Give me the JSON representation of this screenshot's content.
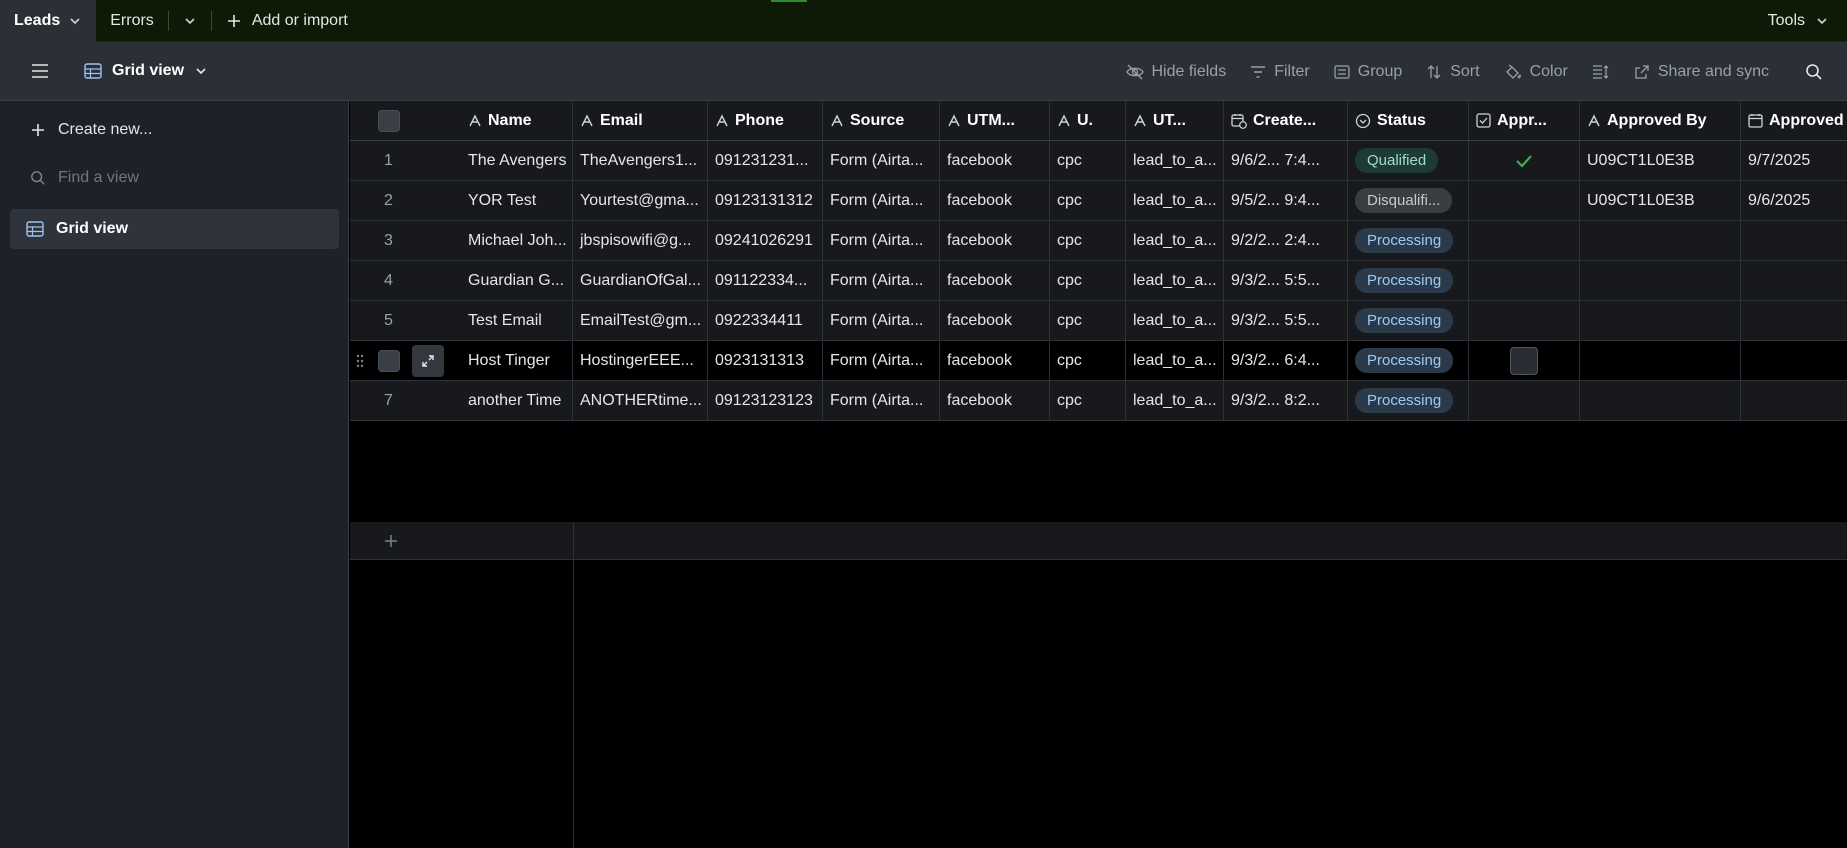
{
  "topbar": {
    "tabs": [
      {
        "label": "Leads"
      },
      {
        "label": "Errors"
      }
    ],
    "add_import_label": "Add or import",
    "tools_label": "Tools"
  },
  "viewbar": {
    "view_name": "Grid view",
    "toolbar": {
      "hide_fields": "Hide fields",
      "filter": "Filter",
      "group": "Group",
      "sort": "Sort",
      "color": "Color",
      "share_sync": "Share and sync"
    }
  },
  "sidebar": {
    "create_new": "Create new...",
    "find_view_placeholder": "Find a view",
    "views": [
      {
        "label": "Grid view"
      }
    ]
  },
  "table": {
    "columns": [
      "Name",
      "Email",
      "Phone",
      "Source",
      "UTM...",
      "U.",
      "UT...",
      "Create...",
      "Status",
      "Appr...",
      "Approved By",
      "Approved"
    ],
    "rows": [
      {
        "idx": "1",
        "name": "The Avengers",
        "email": "TheAvengers1...",
        "phone": "091231231...",
        "source": "Form (Airta...",
        "utm_source": "facebook",
        "utm_medium": "cpc",
        "utm_campaign": "lead_to_a...",
        "created": "9/6/2...  7:4...",
        "status": "Qualified",
        "approved": true,
        "approved_by": "U09CT1L0E3B",
        "approved_date": "9/7/2025"
      },
      {
        "idx": "2",
        "name": "YOR Test",
        "email": "Yourtest@gma...",
        "phone": "09123131312",
        "source": "Form (Airta...",
        "utm_source": "facebook",
        "utm_medium": "cpc",
        "utm_campaign": "lead_to_a...",
        "created": "9/5/2...  9:4...",
        "status": "Disqualifi...",
        "approved": false,
        "approved_by": "U09CT1L0E3B",
        "approved_date": "9/6/2025"
      },
      {
        "idx": "3",
        "name": "Michael Joh...",
        "email": "jbspisowifi@g...",
        "phone": "09241026291",
        "source": "Form (Airta...",
        "utm_source": "facebook",
        "utm_medium": "cpc",
        "utm_campaign": "lead_to_a...",
        "created": "9/2/2...  2:4...",
        "status": "Processing",
        "approved": false,
        "approved_by": "",
        "approved_date": ""
      },
      {
        "idx": "4",
        "name": "Guardian G...",
        "email": "GuardianOfGal...",
        "phone": "091122334...",
        "source": "Form (Airta...",
        "utm_source": "facebook",
        "utm_medium": "cpc",
        "utm_campaign": "lead_to_a...",
        "created": "9/3/2...  5:5...",
        "status": "Processing",
        "approved": false,
        "approved_by": "",
        "approved_date": ""
      },
      {
        "idx": "5",
        "name": "Test Email",
        "email": "EmailTest@gm...",
        "phone": "0922334411",
        "source": "Form (Airta...",
        "utm_source": "facebook",
        "utm_medium": "cpc",
        "utm_campaign": "lead_to_a...",
        "created": "9/3/2...  5:5...",
        "status": "Processing",
        "approved": false,
        "approved_by": "",
        "approved_date": ""
      },
      {
        "idx": "",
        "name": "Host Tinger",
        "email": "HostingerEEE...",
        "phone": "0923131313",
        "source": "Form (Airta...",
        "utm_source": "facebook",
        "utm_medium": "cpc",
        "utm_campaign": "lead_to_a...",
        "created": "9/3/2...  6:4...",
        "status": "Processing",
        "approved": false,
        "approved_by": "",
        "approved_date": ""
      },
      {
        "idx": "7",
        "name": "another Time",
        "email": "ANOTHERtime...",
        "phone": "09123123123",
        "source": "Form (Airta...",
        "utm_source": "facebook",
        "utm_medium": "cpc",
        "utm_campaign": "lead_to_a...",
        "created": "9/3/2...  8:2...",
        "status": "Processing",
        "approved": false,
        "approved_by": "",
        "approved_date": ""
      }
    ]
  },
  "colors": {
    "accent_green": "#2f8a2f",
    "topbar_bg": "#0d1a06",
    "check_green": "#3fae49"
  }
}
